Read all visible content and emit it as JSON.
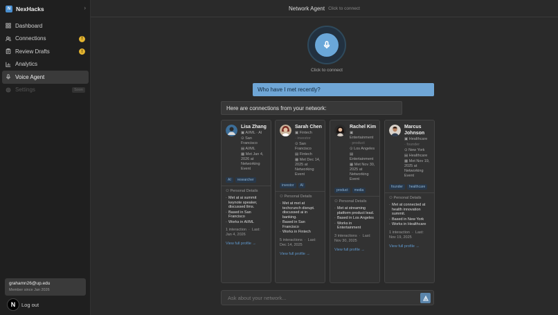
{
  "brand": {
    "logo_letter": "N",
    "name": "NexHacks"
  },
  "nav": [
    {
      "label": "Dashboard",
      "icon": "grid-icon",
      "badge": ""
    },
    {
      "label": "Connections",
      "icon": "users-icon",
      "badge": "!"
    },
    {
      "label": "Review Drafts",
      "icon": "clipboard-icon",
      "badge": "!"
    },
    {
      "label": "Analytics",
      "icon": "chart-icon",
      "badge": ""
    },
    {
      "label": "Voice Agent",
      "icon": "mic-icon",
      "badge": ""
    },
    {
      "label": "Settings",
      "icon": "gear-icon",
      "badge": "Soon"
    }
  ],
  "user": {
    "email": "grahamn26@up.edu",
    "since": "Member since Jan 2026"
  },
  "logout_label": "Log out",
  "next_badge": "N",
  "header": {
    "title": "Network Agent",
    "status": "Click to connect"
  },
  "mic_caption": "Click to connect",
  "user_message": "Who have I met recently?",
  "bot_message": "Here are connections from your network:",
  "colors": {
    "accent": "#6aa7d9",
    "badge": "#e2b330",
    "link": "#5f98cd"
  },
  "cards": [
    {
      "name": "Lisa Zhang",
      "lines": [
        "AI/ML",
        "AI",
        "San Francisco",
        "AI/ML",
        "Met Jan 4, 2026 at Networking Event"
      ],
      "tags": [
        "AI",
        "researcher"
      ],
      "pd_title": "Personal Details",
      "details": [
        "Met at ai summit keynote speaker, discussed llms.",
        "Based in San Francisco",
        "Works in AI/ML"
      ],
      "interactions": "1 interaction",
      "last": "Last: Jan 4, 2026",
      "link": "View full profile →"
    },
    {
      "name": "Sarah Chen",
      "lines": [
        "Fintech",
        "investor",
        "San Francisco",
        "Fintech",
        "Met Dec 14, 2025 at Networking Event"
      ],
      "tags": [
        "investor",
        "AI"
      ],
      "pd_title": "Personal Details",
      "details": [
        "Met at met at techcrunch disrupt. discussed ai in banking.",
        "Based in San Francisco",
        "Works in Fintech"
      ],
      "interactions": "5 interactions",
      "last": "Last: Dec 14, 2025",
      "link": "View full profile →"
    },
    {
      "name": "Rachel Kim",
      "lines": [
        "Entertainment",
        "product",
        "Los Angeles",
        "Entertainment",
        "Met Nov 30, 2025 at Networking Event"
      ],
      "tags": [
        "product",
        "media"
      ],
      "pd_title": "Personal Details",
      "details": [
        "Met at streaming platform product lead.",
        "Based in Los Angeles",
        "Works in Entertainment"
      ],
      "interactions": "3 interactions",
      "last": "Last: Nov 30, 2025",
      "link": "View full profile →"
    },
    {
      "name": "Marcus Johnson",
      "lines": [
        "Healthcare",
        "founder",
        "New York",
        "Healthcare",
        "Met Nov 19, 2025 at Networking Event"
      ],
      "tags": [
        "founder",
        "healthcare"
      ],
      "pd_title": "Personal Details",
      "details": [
        "Met at connected at health innovation summit.",
        "Based in New York",
        "Works in Healthcare"
      ],
      "interactions": "1 interaction",
      "last": "Last: Nov 19, 2025",
      "link": "View full profile →"
    }
  ],
  "input": {
    "placeholder": "Ask about your network..."
  }
}
